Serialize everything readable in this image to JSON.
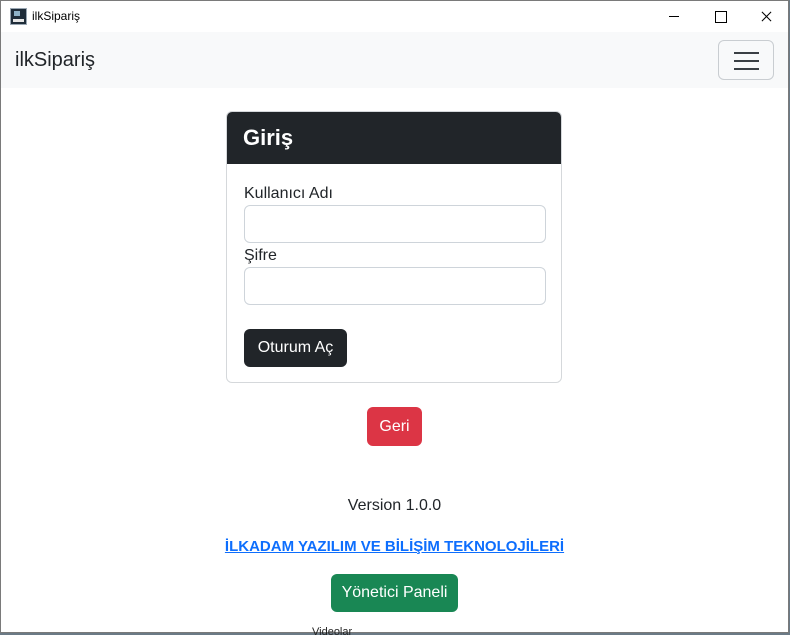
{
  "window": {
    "title": "ilkSipariş",
    "icon": "app-icon"
  },
  "navbar": {
    "brand": "ilkSipariş",
    "toggler_icon": "hamburger-icon"
  },
  "login_card": {
    "header": "Giriş",
    "username_label": "Kullanıcı Adı",
    "username_value": "",
    "password_label": "Şifre",
    "password_value": "",
    "submit_label": "Oturum Aç"
  },
  "back_button": "Geri",
  "footer": {
    "version": "Version 1.0.0",
    "company_link": "İLKADAM YAZILIM VE BİLİŞİM TEKNOLOJİLERİ",
    "admin_button": "Yönetici Paneli"
  },
  "behind_window_text": "Videolar",
  "colors": {
    "dark": "#212529",
    "danger": "#dc3545",
    "success": "#198754",
    "link": "#0d6efd",
    "navbar_bg": "#f8f9fa"
  }
}
